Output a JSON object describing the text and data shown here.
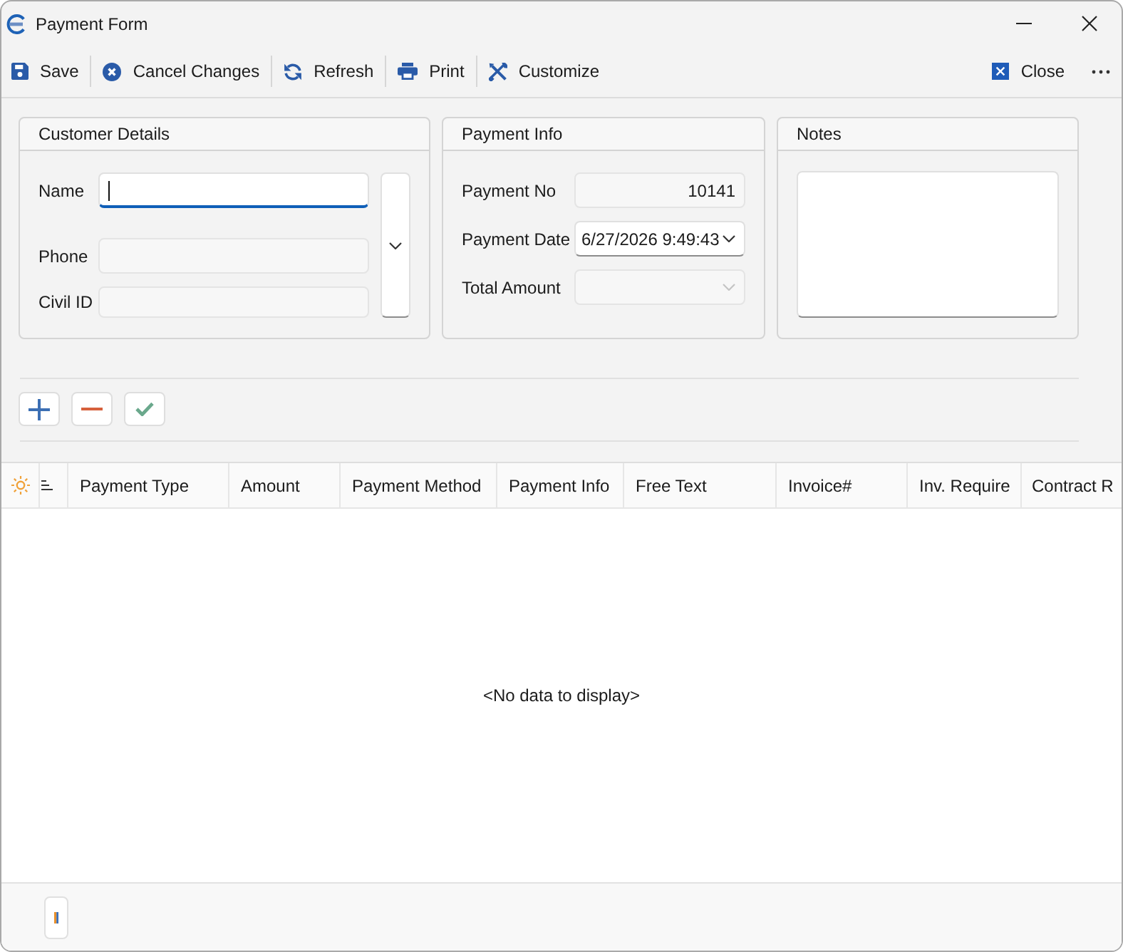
{
  "window": {
    "title": "Payment Form"
  },
  "toolbar": {
    "left": [
      {
        "kind": "save",
        "label": "Save"
      },
      {
        "kind": "cancel",
        "label": "Cancel Changes"
      },
      {
        "kind": "refresh",
        "label": "Refresh"
      },
      {
        "kind": "print",
        "label": "Print"
      },
      {
        "kind": "customize",
        "label": "Customize"
      }
    ],
    "right": [
      {
        "kind": "close",
        "label": "Close"
      }
    ]
  },
  "customer_details": {
    "title": "Customer Details",
    "fields": [
      {
        "label": "Name",
        "focused": true,
        "disabled": false
      },
      {
        "label": "Phone",
        "focused": false,
        "disabled": true
      },
      {
        "label": "Civil ID",
        "focused": false,
        "disabled": true
      }
    ]
  },
  "payment_info": {
    "title": "Payment Info",
    "fields": [
      {
        "label": "Payment No",
        "kind": "text",
        "value": "10141",
        "disabled": true
      },
      {
        "label": "Payment Date",
        "kind": "dropdown",
        "value": "6/27/2026 9:49:43",
        "disabled": false
      },
      {
        "label": "Total Amount",
        "kind": "dropdown",
        "disabled": true
      }
    ]
  },
  "notes": {
    "title": "Notes"
  },
  "row_buttons": [
    {
      "kind": "add"
    },
    {
      "kind": "remove"
    },
    {
      "kind": "confirm"
    }
  ],
  "grid": {
    "columns": [
      "Payment Type",
      "Amount",
      "Payment Method",
      "Payment Info",
      "Free Text",
      "Invoice#",
      "Inv. Require",
      "Contract R"
    ],
    "empty_text": "<No data to display>"
  }
}
